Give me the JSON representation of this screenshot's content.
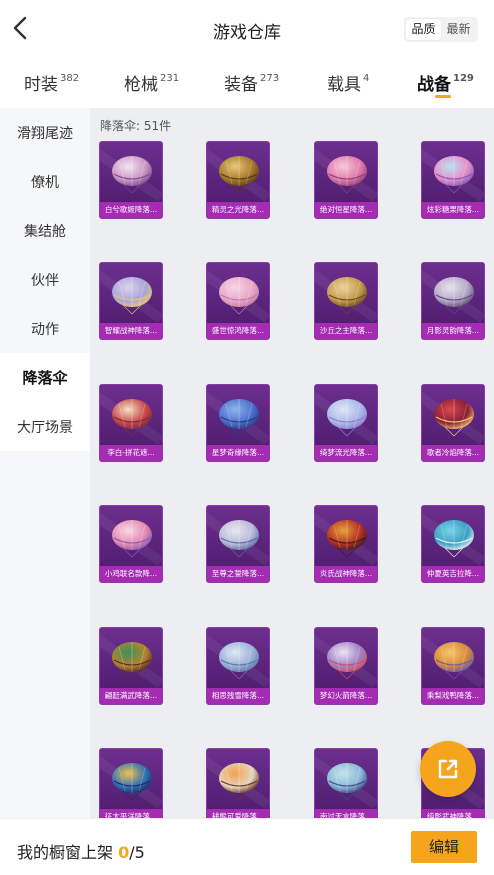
{
  "header": {
    "title": "游戏仓库",
    "sort_options": [
      "品质",
      "最新"
    ]
  },
  "tabs": [
    {
      "label": "时装",
      "count": "382"
    },
    {
      "label": "枪械",
      "count": "231"
    },
    {
      "label": "装备",
      "count": "273"
    },
    {
      "label": "载具",
      "count": "4"
    },
    {
      "label": "战备",
      "count": "129"
    }
  ],
  "sidebar": {
    "items": [
      "滑翔尾迹",
      "僚机",
      "集结舱",
      "伙伴",
      "动作",
      "降落伞",
      "大厅场景"
    ],
    "active": "降落伞"
  },
  "grid": {
    "sub_label": "降落伞: 51件",
    "items": [
      {
        "name": "白兮歌姬降落...",
        "colors": [
          "#f3e6ee",
          "#c995c4",
          "#7b4d8c"
        ]
      },
      {
        "name": "精灵之光降落...",
        "colors": [
          "#e9c976",
          "#a6792a",
          "#5a3b19"
        ]
      },
      {
        "name": "绝对恒星降落...",
        "colors": [
          "#f7c9da",
          "#e07aa8",
          "#8f3e7d"
        ]
      },
      {
        "name": "炫彩糖果降落...",
        "colors": [
          "#b7e3f2",
          "#e88cc8",
          "#7a5fb1"
        ]
      },
      {
        "name": "智耀战神降落...",
        "colors": [
          "#d9d4ec",
          "#a9a4d8",
          "#e9c770"
        ]
      },
      {
        "name": "盛世惊鸿降落...",
        "colors": [
          "#f7d5e6",
          "#e8a7c8",
          "#c07aa6"
        ]
      },
      {
        "name": "沙丘之主降落...",
        "colors": [
          "#eed39a",
          "#c59a4c",
          "#6a4a22"
        ]
      },
      {
        "name": "月影灵韵降落...",
        "colors": [
          "#e8e3ee",
          "#b4a7c6",
          "#5d4e76"
        ]
      },
      {
        "name": "李白-拼花遮...",
        "colors": [
          "#f3e2c6",
          "#c8464a",
          "#7a2c3b"
        ]
      },
      {
        "name": "星梦奇缘降落...",
        "colors": [
          "#8fb6ec",
          "#4b6fcd",
          "#2a3a86"
        ]
      },
      {
        "name": "绮梦流光降落...",
        "colors": [
          "#dfe6f7",
          "#a9b8e8",
          "#8f7fce"
        ]
      },
      {
        "name": "歌者冷焰降落...",
        "colors": [
          "#d9494e",
          "#8a1e36",
          "#f3c86d"
        ]
      },
      {
        "name": "小鸡联名款降...",
        "colors": [
          "#f7d9e5",
          "#e48ab2",
          "#8b5ab5"
        ]
      },
      {
        "name": "至尊之誓降落...",
        "colors": [
          "#e7e7f2",
          "#b7b9d8",
          "#5f6aa6"
        ]
      },
      {
        "name": "炎氏战神降落...",
        "colors": [
          "#e7a236",
          "#b43024",
          "#3b1b1b"
        ]
      },
      {
        "name": "仲夏英吉拉降...",
        "colors": [
          "#7dd4e8",
          "#3a9fc4",
          "#e7f2f6"
        ]
      },
      {
        "name": "翩跹满武降落...",
        "colors": [
          "#3d8f58",
          "#b4842f",
          "#5a2a2a"
        ]
      },
      {
        "name": "相思残雪降落...",
        "colors": [
          "#dfe9f6",
          "#9ab2d6",
          "#5e78a8"
        ]
      },
      {
        "name": "梦幻火箭降落...",
        "colors": [
          "#ede4f2",
          "#9f82c4",
          "#d64b5c"
        ]
      },
      {
        "name": "乘梨戏鸭降落...",
        "colors": [
          "#f6c86a",
          "#d7893a",
          "#6a5aa8"
        ]
      },
      {
        "name": "征太平洋降落...",
        "colors": [
          "#f0c34c",
          "#2f6fb7",
          "#1b2f66"
        ]
      },
      {
        "name": "耕熊可爱降落...",
        "colors": [
          "#f2a04a",
          "#e5d5bf",
          "#6a3a1e"
        ]
      },
      {
        "name": "南过天言降落...",
        "colors": [
          "#bfe6e9",
          "#8fb7d8",
          "#3b4b86"
        ]
      },
      {
        "name": "纯影武神降落...",
        "colors": [
          "#9fd8de",
          "#6a8fc4",
          "#3a3a6a"
        ]
      }
    ]
  },
  "bottom": {
    "showcase_prefix": "我的橱窗上架",
    "showcase_count": "0",
    "showcase_total": "/5",
    "edit_label": "编辑"
  },
  "accent_color": "#f5a623"
}
